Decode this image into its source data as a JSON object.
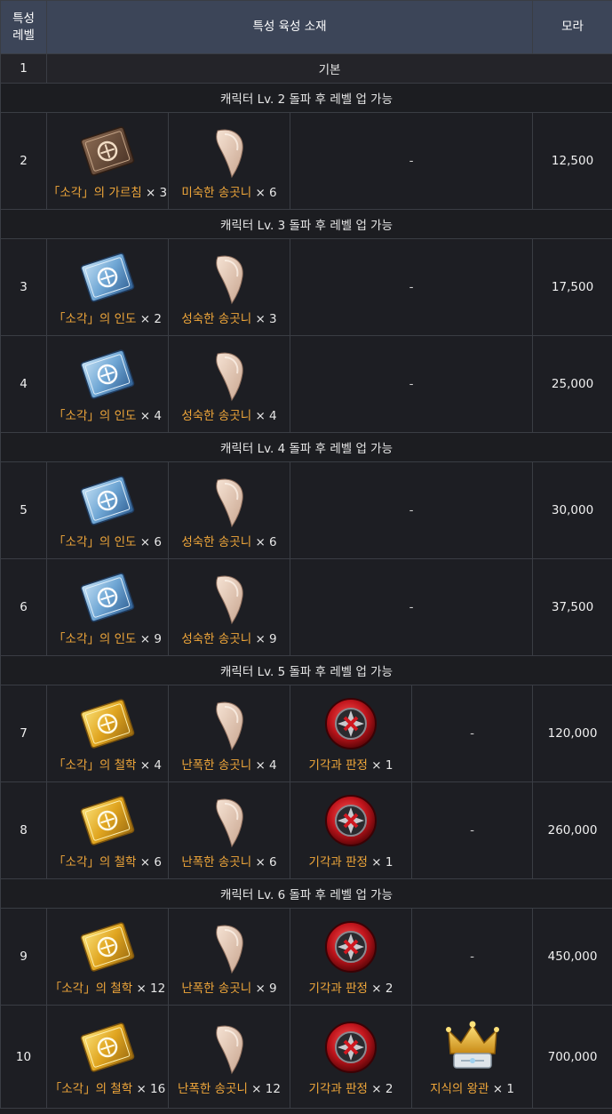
{
  "header": {
    "level_label_line1": "특성",
    "level_label_line2": "레벨",
    "materials_label": "특성 육성 소재",
    "mora_label": "모라"
  },
  "colors": {
    "name_accent": "#f0a73a",
    "header_bg": "#3c4558",
    "page_bg": "#1e1e22"
  },
  "rows": [
    {
      "kind": "basic",
      "level": "1",
      "text": "기본"
    },
    {
      "kind": "sep",
      "text": "캐릭터 Lv. 2 돌파 후 레벨 업 가능"
    },
    {
      "kind": "mat",
      "level": "2",
      "mora": "12,500",
      "dash": "-",
      "items": [
        {
          "icon": "teachings-book-icon",
          "name": "「소각」의 가르침",
          "qty": "× 3"
        },
        {
          "icon": "tooth-icon",
          "name": "미숙한 송곳니",
          "qty": "× 6"
        }
      ]
    },
    {
      "kind": "sep",
      "text": "캐릭터 Lv. 3 돌파 후 레벨 업 가능"
    },
    {
      "kind": "mat",
      "level": "3",
      "mora": "17,500",
      "dash": "-",
      "items": [
        {
          "icon": "guide-book-icon",
          "name": "「소각」의 인도",
          "qty": "× 2"
        },
        {
          "icon": "tooth-icon",
          "name": "성숙한 송곳니",
          "qty": "× 3"
        }
      ]
    },
    {
      "kind": "mat",
      "level": "4",
      "mora": "25,000",
      "dash": "-",
      "items": [
        {
          "icon": "guide-book-icon",
          "name": "「소각」의 인도",
          "qty": "× 4"
        },
        {
          "icon": "tooth-icon",
          "name": "성숙한 송곳니",
          "qty": "× 4"
        }
      ]
    },
    {
      "kind": "sep",
      "text": "캐릭터 Lv. 4 돌파 후 레벨 업 가능"
    },
    {
      "kind": "mat",
      "level": "5",
      "mora": "30,000",
      "dash": "-",
      "items": [
        {
          "icon": "guide-book-icon",
          "name": "「소각」의 인도",
          "qty": "× 6"
        },
        {
          "icon": "tooth-icon",
          "name": "성숙한 송곳니",
          "qty": "× 6"
        }
      ]
    },
    {
      "kind": "mat",
      "level": "6",
      "mora": "37,500",
      "dash": "-",
      "items": [
        {
          "icon": "guide-book-icon",
          "name": "「소각」의 인도",
          "qty": "× 9"
        },
        {
          "icon": "tooth-icon",
          "name": "성숙한 송곳니",
          "qty": "× 9"
        }
      ]
    },
    {
      "kind": "sep",
      "text": "캐릭터 Lv. 5 돌파 후 레벨 업 가능"
    },
    {
      "kind": "mat",
      "level": "7",
      "mora": "120,000",
      "dash": "-",
      "items": [
        {
          "icon": "philosophy-book-icon",
          "name": "「소각」의 철학",
          "qty": "× 4"
        },
        {
          "icon": "tooth-icon",
          "name": "난폭한 송곳니",
          "qty": "× 4"
        },
        {
          "icon": "red-emblem-icon",
          "name": "기각과 판정",
          "qty": "× 1"
        }
      ]
    },
    {
      "kind": "mat",
      "level": "8",
      "mora": "260,000",
      "dash": "-",
      "items": [
        {
          "icon": "philosophy-book-icon",
          "name": "「소각」의 철학",
          "qty": "× 6"
        },
        {
          "icon": "tooth-icon",
          "name": "난폭한 송곳니",
          "qty": "× 6"
        },
        {
          "icon": "red-emblem-icon",
          "name": "기각과 판정",
          "qty": "× 1"
        }
      ]
    },
    {
      "kind": "sep",
      "text": "캐릭터 Lv. 6 돌파 후 레벨 업 가능"
    },
    {
      "kind": "mat",
      "level": "9",
      "mora": "450,000",
      "dash": "-",
      "items": [
        {
          "icon": "philosophy-book-icon",
          "name": "「소각」의 철학",
          "qty": "× 12"
        },
        {
          "icon": "tooth-icon",
          "name": "난폭한 송곳니",
          "qty": "× 9"
        },
        {
          "icon": "red-emblem-icon",
          "name": "기각과 판정",
          "qty": "× 2"
        }
      ]
    },
    {
      "kind": "mat",
      "level": "10",
      "mora": "700,000",
      "dash": "",
      "items": [
        {
          "icon": "philosophy-book-icon",
          "name": "「소각」의 철학",
          "qty": "× 16"
        },
        {
          "icon": "tooth-icon",
          "name": "난폭한 송곳니",
          "qty": "× 12"
        },
        {
          "icon": "red-emblem-icon",
          "name": "기각과 판정",
          "qty": "× 2"
        },
        {
          "icon": "crown-icon",
          "name": "지식의 왕관",
          "qty": "× 1"
        }
      ]
    }
  ]
}
